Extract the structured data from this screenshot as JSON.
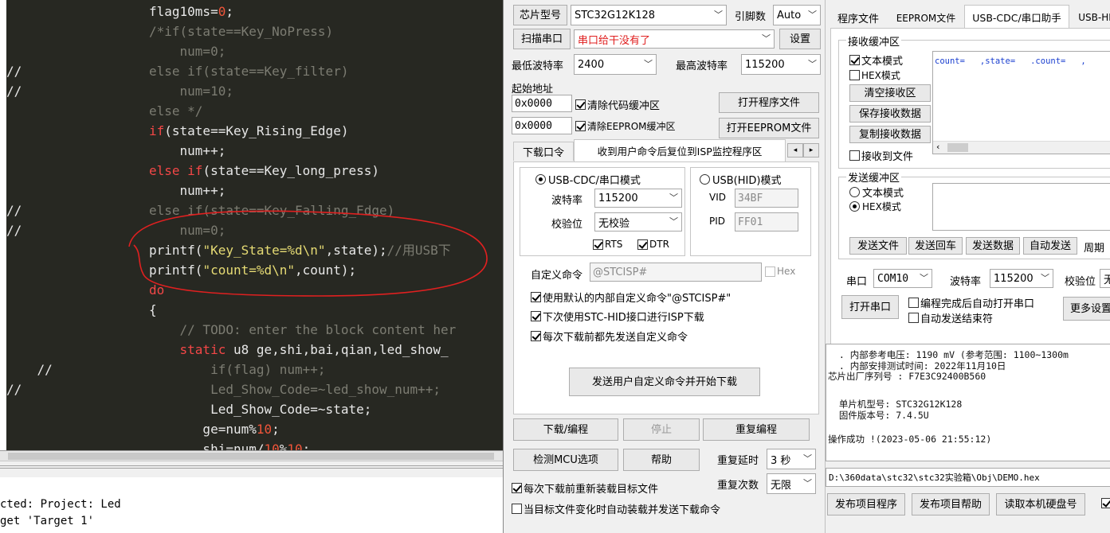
{
  "editor": {
    "lines": [
      {
        "prefix": "",
        "parts": [
          {
            "t": "flag10ms=",
            "c": "pl"
          },
          {
            "t": "0",
            "c": "nm"
          },
          {
            "t": ";",
            "c": "pl"
          }
        ]
      },
      {
        "prefix": "",
        "parts": [
          {
            "t": "/*if(state==Key_NoPress)",
            "c": "cm"
          }
        ]
      },
      {
        "prefix": "",
        "parts": [
          {
            "t": "    num=0;",
            "c": "cm"
          }
        ]
      },
      {
        "prefix": "//",
        "parts": [
          {
            "t": "else if(state==Key_filter)",
            "c": "cm"
          }
        ]
      },
      {
        "prefix": "//",
        "parts": [
          {
            "t": "    num=10;",
            "c": "cm"
          }
        ]
      },
      {
        "prefix": "",
        "parts": [
          {
            "t": "else */",
            "c": "cm"
          }
        ]
      },
      {
        "prefix": "",
        "parts": [
          {
            "t": "if",
            "c": "kw"
          },
          {
            "t": "(state==Key_Rising_Edge)",
            "c": "pl"
          }
        ]
      },
      {
        "prefix": "",
        "parts": [
          {
            "t": "    num++;",
            "c": "pl"
          }
        ]
      },
      {
        "prefix": "",
        "parts": [
          {
            "t": "else if",
            "c": "kw"
          },
          {
            "t": "(state==Key_long_press)",
            "c": "pl"
          }
        ]
      },
      {
        "prefix": "",
        "parts": [
          {
            "t": "    num++;",
            "c": "pl"
          }
        ]
      },
      {
        "prefix": "//",
        "parts": [
          {
            "t": "else if(state==Key_Falling_Edge)",
            "c": "cm"
          }
        ]
      },
      {
        "prefix": "//",
        "parts": [
          {
            "t": "    num=0;",
            "c": "cm"
          }
        ]
      },
      {
        "prefix": "",
        "parts": [
          {
            "t": "printf(",
            "c": "pl"
          },
          {
            "t": "\"Key_State=%d\\n\"",
            "c": "st"
          },
          {
            "t": ",state);",
            "c": "pl"
          },
          {
            "t": "//用USB下",
            "c": "cm"
          }
        ]
      },
      {
        "prefix": "",
        "parts": [
          {
            "t": "printf(",
            "c": "pl"
          },
          {
            "t": "\"count=%d\\n\"",
            "c": "st"
          },
          {
            "t": ",count);",
            "c": "pl"
          }
        ]
      },
      {
        "prefix": "",
        "parts": [
          {
            "t": "do",
            "c": "kw"
          }
        ]
      },
      {
        "prefix": "",
        "parts": [
          {
            "t": "{",
            "c": "pl"
          }
        ]
      },
      {
        "prefix": "",
        "parts": [
          {
            "t": "    // TODO: enter the block content her",
            "c": "cm"
          }
        ]
      },
      {
        "prefix": "",
        "parts": [
          {
            "t": "    ",
            "c": "pl"
          },
          {
            "t": "static",
            "c": "kw"
          },
          {
            "t": " u8 ge,shi,bai,qian,led_show_",
            "c": "pl"
          }
        ]
      },
      {
        "prefix": "    //",
        "parts": [
          {
            "t": "        if(flag) num++;",
            "c": "cm"
          }
        ]
      },
      {
        "prefix": "//",
        "parts": [
          {
            "t": "        Led_Show_Code=~led_show_num++;",
            "c": "cm"
          }
        ]
      },
      {
        "prefix": "",
        "parts": [
          {
            "t": "        Led_Show_Code=~state;",
            "c": "pl"
          }
        ]
      },
      {
        "prefix": "",
        "parts": [
          {
            "t": "       ge=num%",
            "c": "pl"
          },
          {
            "t": "10",
            "c": "nm"
          },
          {
            "t": ";",
            "c": "pl"
          }
        ]
      },
      {
        "prefix": "",
        "parts": [
          {
            "t": "       shi=num/",
            "c": "pl"
          },
          {
            "t": "10",
            "c": "nm"
          },
          {
            "t": "%",
            "c": "pl"
          },
          {
            "t": "10",
            "c": "nm"
          },
          {
            "t": ";",
            "c": "pl"
          }
        ]
      }
    ],
    "build_output": [
      "cted: Project: Led",
      "get 'Target 1'"
    ]
  },
  "isp": {
    "chip_label": "芯片型号",
    "chip_value": "STC32G12K128",
    "pins_label": "引脚数",
    "pins_value": "Auto",
    "scan_port": "扫描串口",
    "port_value": "串口给干没有了",
    "settings": "设置",
    "min_baud_label": "最低波特率",
    "min_baud": "2400",
    "max_baud_label": "最高波特率",
    "max_baud": "115200",
    "start_addr_label": "起始地址",
    "addr1": "0x0000",
    "clear_code": "清除代码缓冲区",
    "open_program": "打开程序文件",
    "addr2": "0x0000",
    "clear_eeprom": "清除EEPROM缓冲区",
    "open_eeprom": "打开EEPROM文件",
    "tab_download": "下载口令",
    "tab_reset": "收到用户命令后复位到ISP监控程序区",
    "mode_cdc": "USB-CDC/串口模式",
    "mode_hid": "USB(HID)模式",
    "baud_label": "波特率",
    "baud_value": "115200",
    "parity_label": "校验位",
    "parity_value": "无校验",
    "rts": "RTS",
    "dtr": "DTR",
    "vid_label": "VID",
    "vid_value": "34BF",
    "pid_label": "PID",
    "pid_value": "FF01",
    "custom_cmd_label": "自定义命令",
    "custom_cmd_value": "@STCISP#",
    "hex_label": "Hex",
    "opt_default_cmd": "使用默认的内部自定义命令\"@STCISP#\"",
    "opt_next_hid": "下次使用STC-HID接口进行ISP下载",
    "opt_send_before": "每次下载前都先发送自定义命令",
    "send_and_download": "发送用户自定义命令并开始下载",
    "download_btn": "下载/编程",
    "stop_btn": "停止",
    "reprogram_btn": "重复编程",
    "check_mcu_btn": "检测MCU选项",
    "help_btn": "帮助",
    "repeat_delay_label": "重复延时",
    "repeat_delay": "3 秒",
    "repeat_count_label": "重复次数",
    "repeat_count": "无限",
    "reload_before": "每次下载前重新装载目标文件",
    "auto_reload": "当目标文件变化时自动装载并发送下载命令",
    "tabs": [
      "程序文件",
      "EEPROM文件",
      "USB-CDC/串口助手",
      "USB-HI"
    ],
    "recv_group": "接收缓冲区",
    "recv_text_mode": "文本模式",
    "recv_hex_mode": "HEX模式",
    "clear_recv": "清空接收区",
    "save_recv": "保存接收数据",
    "copy_recv": "复制接收数据",
    "recv_to_file": "接收到文件",
    "recv_content": "count=   ,state=   .count=   ,",
    "send_group": "发送缓冲区",
    "send_text_mode": "文本模式",
    "send_hex_mode": "HEX模式",
    "send_file": "发送文件",
    "send_return": "发送回车",
    "send_data": "发送数据",
    "auto_send": "自动发送",
    "period_label": "周期",
    "port_label": "串口",
    "port_com": "COM10",
    "baud2_label": "波特率",
    "baud2_value": "115200",
    "parity2_label": "校验位",
    "parity2_value": "无",
    "open_port": "打开串口",
    "auto_open": "编程完成后自动打开串口",
    "auto_end": "自动发送结束符",
    "more_settings": "更多设置",
    "log": [
      "  . 内部参考电压: 1190 mV (参考范围: 1100~1300m",
      "  . 内部安排测试时间: 2022年11月10日",
      "芯片出厂序列号 : F7E3C92400B560",
      "",
      "  单片机型号: STC32G12K128",
      "  固件版本号: 7.4.5U",
      "",
      "操作成功 !(2023-05-06 21:55:12)"
    ],
    "hex_path": "D:\\360data\\stc32\\stc32实验箱\\Obj\\DEMO.hex",
    "publish_program": "发布项目程序",
    "publish_help": "发布项目帮助",
    "read_disk": "读取本机硬盘号"
  }
}
